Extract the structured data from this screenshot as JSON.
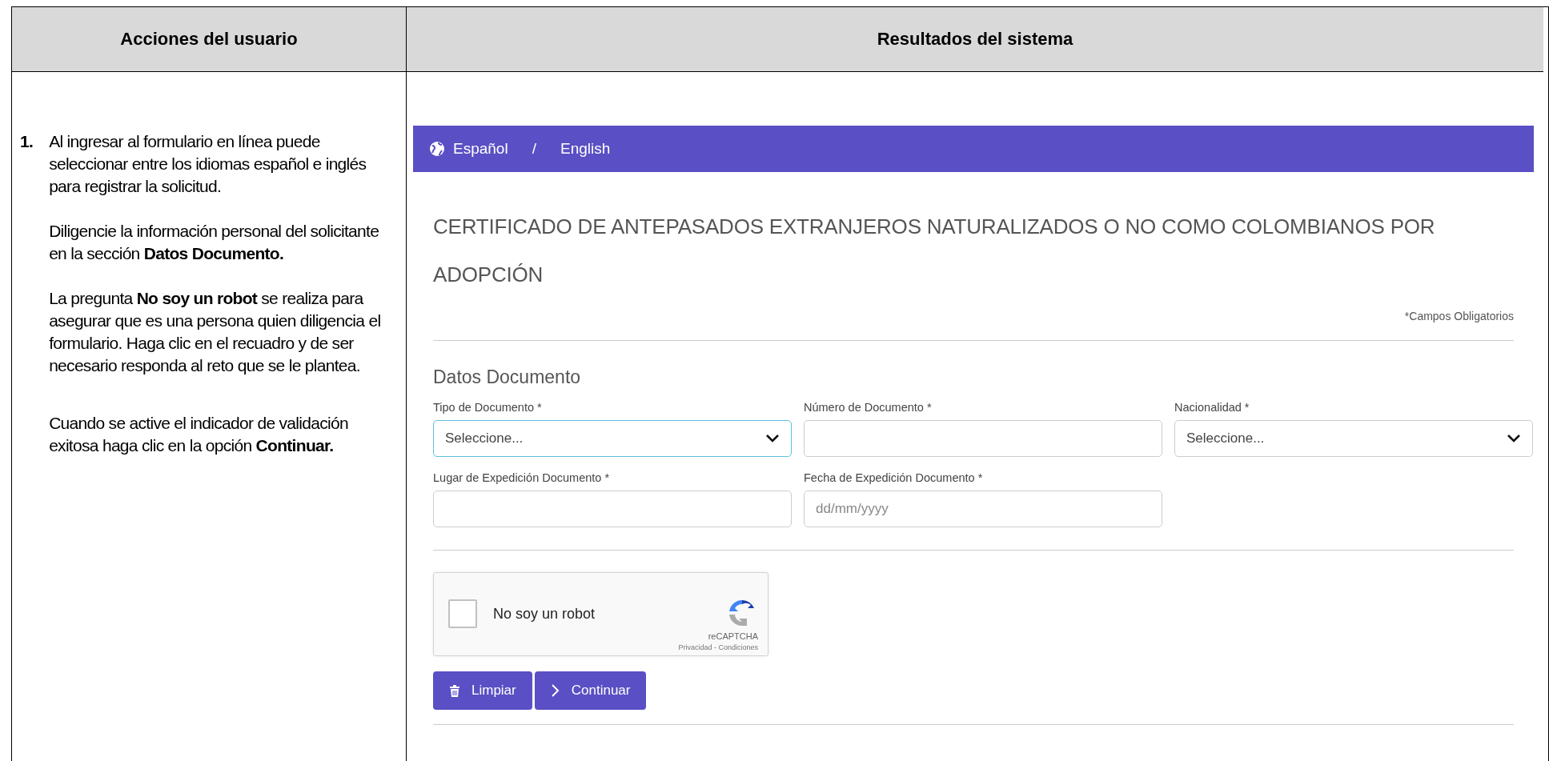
{
  "table": {
    "columns": [
      "Acciones del usuario",
      "Resultados del sistema"
    ],
    "rows": [
      {
        "step": "1.",
        "paragraphs": [
          "Al ingresar al formulario en línea puede seleccionar entre los idiomas español e inglés para registrar la solicitud.",
          "Diligencie la información personal del solicitante en la sección **Datos Documento.**",
          "La pregunta **No soy un robot** se realiza para asegurar que es una persona quien diligencia el formulario. Haga clic en el recuadro y de ser necesario responda al reto que se le plantea.",
          "Cuando se active el indicador de validación exitosa haga clic en la opción **Continuar.**"
        ],
        "form": {
          "languages": [
            "Español",
            "/",
            "English"
          ],
          "title": "CERTIFICADO DE ANTEPASADOS EXTRANJEROS NATURALIZADOS O NO COMO COLOMBIANOS POR ADOPCIÓN",
          "required_note": "*Campos Obligatorios",
          "section_title": "Datos Documento",
          "fields": [
            {
              "kind": "select",
              "label": "Tipo de Documento *",
              "value": "Seleccione...",
              "focused": true
            },
            {
              "kind": "input",
              "label": "Número de Documento *",
              "focused": false
            },
            {
              "kind": "select",
              "label": "Nacionalidad *",
              "value": "Seleccione...",
              "focused": false
            },
            {
              "kind": "input",
              "label": "Lugar de Expedición Documento *",
              "focused": false
            },
            {
              "kind": "input",
              "label": "Fecha de Expedición Documento *",
              "placeholder": "dd/mm/yyyy",
              "focused": false
            }
          ],
          "captcha": {
            "label": "No soy un robot",
            "checked": false,
            "brand": "reCAPTCHA",
            "links": "Privacidad - Condiciones"
          },
          "buttons": [
            {
              "kind": "clear",
              "label": "Limpiar"
            },
            {
              "kind": "next",
              "label": "Continuar"
            }
          ]
        }
      }
    ]
  }
}
